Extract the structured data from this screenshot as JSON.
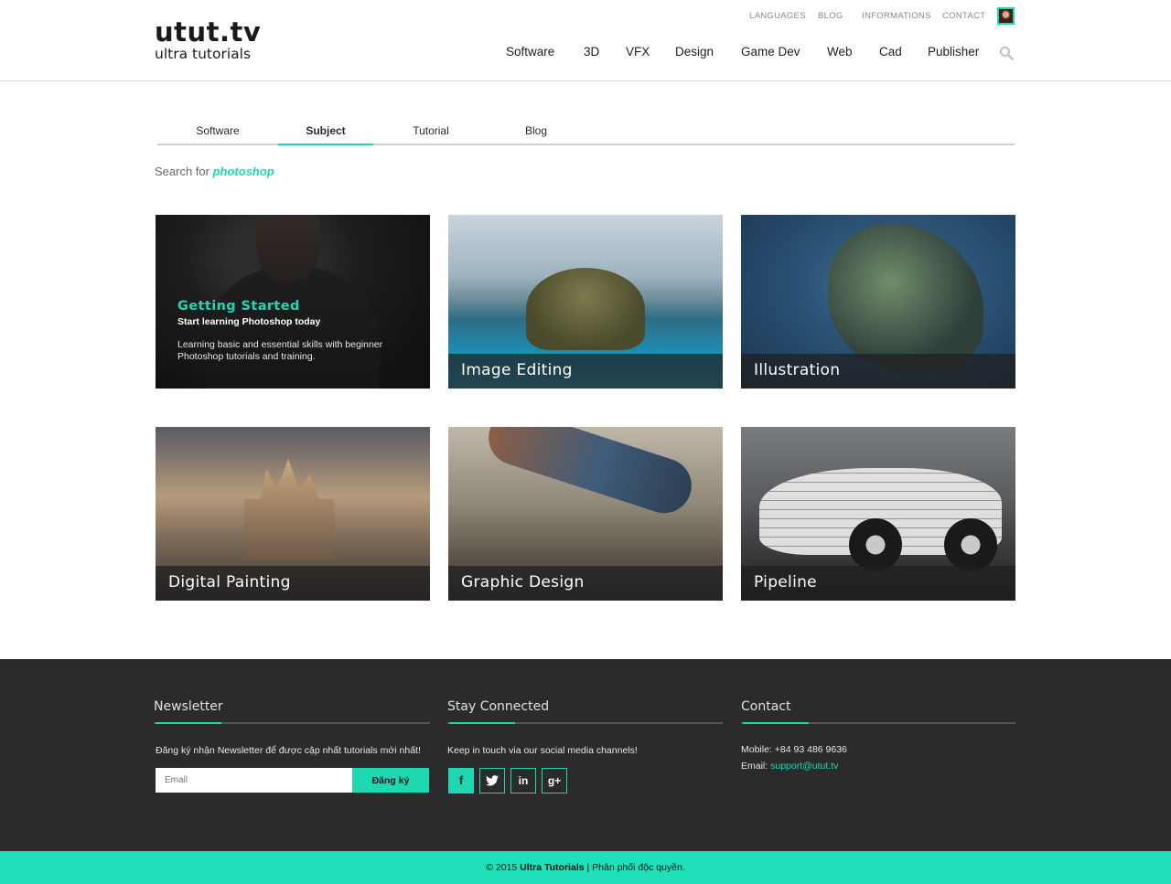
{
  "header": {
    "logo_main": "utut.tv",
    "logo_sub": "ultra tutorials",
    "top_links": [
      "LANGUAGES",
      "BLOG",
      "INFORMATIONS",
      "CONTACT"
    ],
    "nav": [
      "Software",
      "3D",
      "VFX",
      "Design",
      "Game Dev",
      "Web",
      "Cad",
      "Publisher"
    ]
  },
  "tabs": [
    "Software",
    "Subject",
    "Tutorial",
    "Blog"
  ],
  "active_tab": "Subject",
  "search": {
    "prefix": "Search for",
    "term": "photoshop"
  },
  "featured": {
    "title": "Getting Started",
    "subtitle": "Start learning Photoshop today",
    "description": "Learning basic and essential skills with beginner Photoshop tutorials and training."
  },
  "cards": [
    "Image Editing",
    "Illustration",
    "Digital Painting",
    "Graphic Design",
    "Pipeline"
  ],
  "footer": {
    "newsletter": {
      "heading": "Newsletter",
      "text": "Đăng ký nhận Newsletter để được cập nhất tutorials mới nhất!",
      "email_placeholder": "Email",
      "button": "Đăng ký"
    },
    "social": {
      "heading": "Stay Connected",
      "text": "Keep in touch via our social media channels!",
      "icons": [
        "facebook-icon",
        "twitter-icon",
        "linkedin-icon",
        "google-plus-icon"
      ]
    },
    "contact": {
      "heading": "Contact",
      "mobile_label": "Mobile:",
      "mobile": "+84 93 486 9636",
      "email_label": "Email:",
      "email": "support@utut.tv"
    }
  },
  "copyright": {
    "prefix": "© 2015",
    "brand": "Ultra Tutorials",
    "separator": "|",
    "suffix": "Phân phối độc quyền."
  },
  "colors": {
    "accent": "#1fd8b2",
    "footer_bg": "#2b2b2b",
    "copyright_bg": "#1fe0b8"
  }
}
